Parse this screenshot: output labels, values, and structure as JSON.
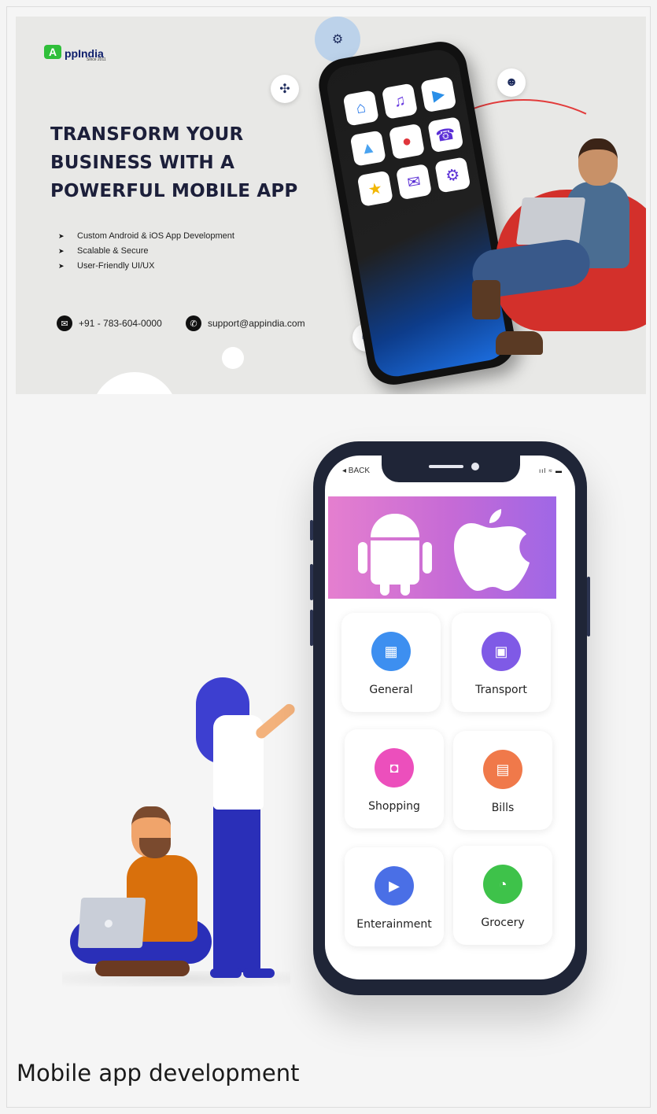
{
  "banner": {
    "logo": {
      "text": "ppIndia",
      "mark": "A",
      "since": "Since 2011"
    },
    "headline": [
      "TRANSFORM YOUR",
      "BUSINESS WITH A",
      "POWERFUL MOBILE APP"
    ],
    "bullets": [
      "Custom Android & iOS App Development",
      "Scalable & Secure",
      "User-Friendly UI/UX"
    ],
    "phone": "+91 - 783-604-0000",
    "email": "support@appindia.com",
    "app_icons": [
      "⌂",
      "♫",
      "▶",
      "▲",
      "●",
      "☎",
      "★",
      "✉",
      "⚙"
    ]
  },
  "device": {
    "back_label": "◂ BACK",
    "status": "ııl ≈ ▬",
    "categories": [
      {
        "label": "General",
        "icon": "grid-icon",
        "glyph": "▦",
        "color": "#3d8ff0"
      },
      {
        "label": "Transport",
        "icon": "bus-icon",
        "glyph": "▣",
        "color": "#7f5ae6"
      },
      {
        "label": "Shopping",
        "icon": "bag-icon",
        "glyph": "◘",
        "color": "#ec4fbc"
      },
      {
        "label": "Bills",
        "icon": "receipt-icon",
        "glyph": "▤",
        "color": "#f0794a"
      },
      {
        "label": "Enterainment",
        "icon": "clapper-icon",
        "glyph": "▶",
        "color": "#4a6fe6"
      },
      {
        "label": "Grocery",
        "icon": "banana-icon",
        "glyph": "◔",
        "color": "#3ec24a"
      }
    ]
  },
  "caption": "Mobile app development"
}
